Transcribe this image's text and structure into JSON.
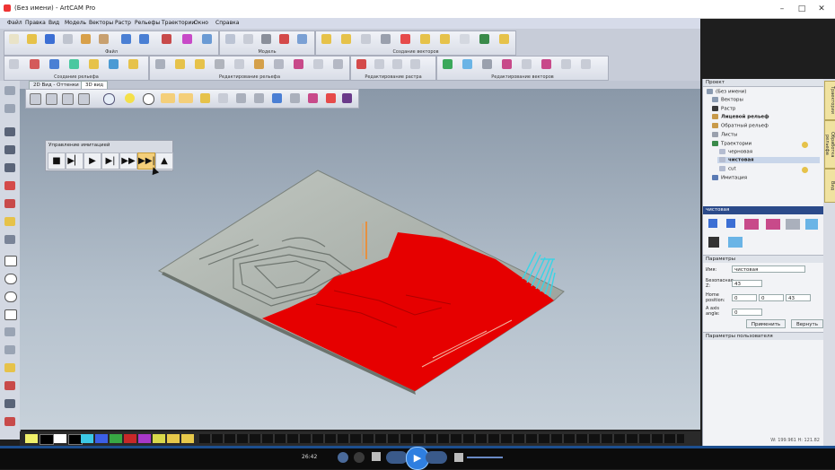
{
  "window": {
    "title": "(Без имени) - ArtCAM Pro",
    "minimize": "–",
    "maximize": "□",
    "close": "✕"
  },
  "menu": [
    "Файл",
    "Правка",
    "Вид",
    "Модель",
    "Векторы",
    "Растр",
    "Рельефы",
    "Траектории",
    "Окно",
    "Справка"
  ],
  "toolbar_groups": {
    "file": "Файл",
    "model": "Модель",
    "create_vectors": "Создание векторов",
    "create_relief": "Создание рельефа",
    "edit_relief": "Редактирование рельефа",
    "edit_raster": "Редактирование растра",
    "edit_vectors": "Редактирование векторов"
  },
  "view_tabs": [
    "2D Вид - Оттенки",
    "3D вид"
  ],
  "simulation_panel": {
    "title": "Управление имитацией",
    "buttons": [
      "stop",
      "play-step",
      "play",
      "step-end",
      "fast-forward",
      "skip-end",
      "home"
    ]
  },
  "project_panel": {
    "header": "Проект",
    "tree": [
      {
        "label": "(Без имени)",
        "bold": false,
        "level": 0
      },
      {
        "label": "Векторы",
        "bold": false,
        "level": 1
      },
      {
        "label": "Растр",
        "bold": false,
        "level": 1
      },
      {
        "label": "Лицевой рельеф",
        "bold": true,
        "level": 1
      },
      {
        "label": "Обратный рельеф",
        "bold": false,
        "level": 1
      },
      {
        "label": "Листы",
        "bold": false,
        "level": 1
      },
      {
        "label": "Траектории",
        "bold": false,
        "level": 1
      },
      {
        "label": "черновая",
        "bold": false,
        "level": 2
      },
      {
        "label": "чистовая",
        "bold": true,
        "level": 2
      },
      {
        "label": "cut",
        "bold": false,
        "level": 2
      },
      {
        "label": "Имитация",
        "bold": false,
        "level": 1
      }
    ]
  },
  "toolpath_panel": {
    "header": "чистовая",
    "params_header": "Параметры",
    "name_label": "Имя:",
    "name_value": "чистовая",
    "safe_z_label": "Безопасная Z:",
    "safe_z_value": "43",
    "home_label": "Home position:",
    "home_x": "0",
    "home_y": "0",
    "home_z": "43",
    "a_axis_label": "A axis angle:",
    "a_axis_value": "0",
    "apply_btn": "Применить",
    "revert_btn": "Вернуть",
    "user_params_header": "Параметры пользователя"
  },
  "side_tabs": [
    "Траектории",
    "Обработка рельефа",
    "Вид"
  ],
  "status": {
    "readout": "W: 199.961  H: 121.82"
  },
  "taskbar": {
    "time": "26:42"
  },
  "colors": {
    "relief_gray": "#a9b0aa",
    "simulated_red": "#e60000",
    "tool_cyan": "#39d4e6",
    "highlight": "#f4cf7a"
  },
  "palette_colors": [
    "#f0f06a",
    "#000000",
    "#ffffff",
    "#000000",
    "#3cc9e6",
    "#3c5fe6",
    "#38a844",
    "#c82828",
    "#a838c8",
    "#d8d84a",
    "#e6c84a",
    "#e6c84a"
  ]
}
